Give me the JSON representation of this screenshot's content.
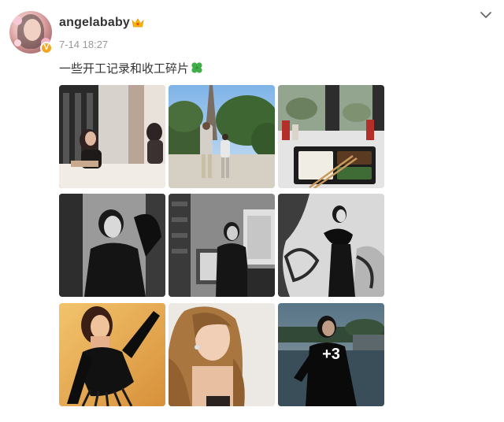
{
  "post": {
    "author": {
      "username": "angelababy",
      "verified_badge": "V",
      "avatar_icon": "avatar-portrait",
      "crown_icon": "crown-icon"
    },
    "timestamp": "7-14 18:27",
    "text": "一些开工记录和收工碎片",
    "text_emoji": "four-leaf-clover-icon",
    "menu_icon": "chevron-down-icon",
    "photos": [
      {
        "id": "photo-1",
        "desc": "woman seated at cafe table by window"
      },
      {
        "id": "photo-2",
        "desc": "two people walking on path, Eiffel Tower"
      },
      {
        "id": "photo-3",
        "desc": "lunch box on table by window"
      },
      {
        "id": "photo-4",
        "desc": "black and white portrait in black dress"
      },
      {
        "id": "photo-5",
        "desc": "black and white photo seated by chest"
      },
      {
        "id": "photo-6",
        "desc": "black and white photo in front of graffiti"
      },
      {
        "id": "photo-7",
        "desc": "woman in black corset dress with gloves"
      },
      {
        "id": "photo-8",
        "desc": "close-up portrait with long hair"
      },
      {
        "id": "photo-9",
        "desc": "woman by river at dusk"
      }
    ],
    "more_count": "+3",
    "colors": {
      "username": "#333333",
      "timestamp": "#999999",
      "verified": "#f5a623",
      "crown": "#f7b500",
      "clover": "#3fae49"
    }
  }
}
